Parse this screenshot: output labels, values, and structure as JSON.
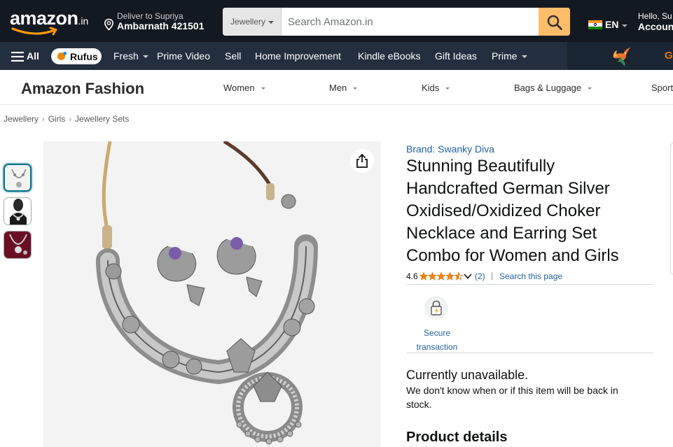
{
  "header": {
    "logo_text": "amazon",
    "logo_tld": ".in",
    "deliver_line1": "Deliver to Supriya",
    "deliver_line2": "Ambarnath 421501",
    "search_category": "Jewellery",
    "search_placeholder": "Search Amazon.in",
    "language": "EN",
    "hello": "Hello, Su",
    "account": "Account"
  },
  "subnav": {
    "all_label": "All",
    "rufus_label": "Rufus",
    "links": [
      "Fresh",
      "Prime Video",
      "Sell",
      "Home Improvement",
      "Kindle eBooks",
      "Gift Ideas",
      "Prime"
    ],
    "promo_partial": "G"
  },
  "fashion": {
    "title": "Amazon Fashion",
    "categories": [
      "Women",
      "Men",
      "Kids",
      "Bags & Luggage",
      "Sport"
    ]
  },
  "breadcrumb": [
    "Jewellery",
    "Girls",
    "Jewellery Sets"
  ],
  "product": {
    "brand": "Brand: Swanky Diva",
    "title": "Stunning Beautifully Handcrafted German Silver Oxidised/Oxidized Choker Necklace and Earring Set Combo for Women and Girls",
    "rating": "4.6",
    "rating_value": 4.6,
    "review_count": "(2)",
    "search_this_page": "Search this page",
    "secure_transaction": "Secure transaction",
    "availability": "Currently unavailable.",
    "availability_note": "We don't know when or if this item will be back in stock.",
    "product_details_heading": "Product details"
  },
  "colors": {
    "nav_dark": "#131921",
    "nav_secondary": "#232f3e",
    "search_button": "#febd69",
    "link": "#2162a1",
    "star": "#f08804"
  }
}
